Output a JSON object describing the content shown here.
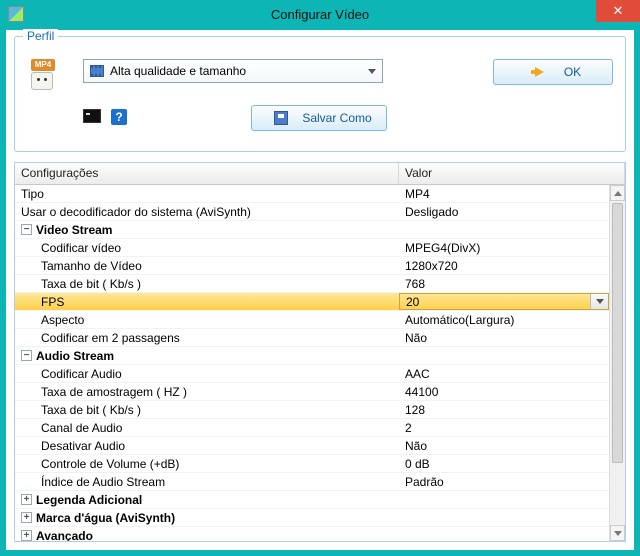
{
  "window": {
    "title": "Configurar Vídeo"
  },
  "fieldset": {
    "legend": "Perfil",
    "format_badge": "MP4",
    "profile_selected": "Alta qualidade e tamanho",
    "ok_label": "OK",
    "help_glyph": "?",
    "save_as_label": "Salvar Como"
  },
  "grid": {
    "header_settings": "Configurações",
    "header_value": "Valor",
    "rows": [
      {
        "kind": "leaf",
        "label": "Tipo",
        "value": "MP4"
      },
      {
        "kind": "leaf",
        "label": "Usar o decodificador do sistema (AviSynth)",
        "value": "Desligado"
      },
      {
        "kind": "group",
        "state": "minus",
        "label": "Video Stream"
      },
      {
        "kind": "child",
        "label": "Codificar vídeo",
        "value": "MPEG4(DivX)"
      },
      {
        "kind": "child",
        "label": "Tamanho de Vídeo",
        "value": "1280x720"
      },
      {
        "kind": "child",
        "label": "Taxa de bit ( Kb/s )",
        "value": "768"
      },
      {
        "kind": "child",
        "label": "FPS",
        "value": "20",
        "selected": true
      },
      {
        "kind": "child",
        "label": "Aspecto",
        "value": "Automático(Largura)"
      },
      {
        "kind": "child",
        "label": "Codificar em 2 passagens",
        "value": "Não"
      },
      {
        "kind": "group",
        "state": "minus",
        "label": "Audio Stream"
      },
      {
        "kind": "child",
        "label": "Codificar Audio",
        "value": "AAC"
      },
      {
        "kind": "child",
        "label": "Taxa de amostragem ( HZ )",
        "value": "44100"
      },
      {
        "kind": "child",
        "label": "Taxa de bit ( Kb/s )",
        "value": "128"
      },
      {
        "kind": "child",
        "label": "Canal de Audio",
        "value": "2"
      },
      {
        "kind": "child",
        "label": "Desativar Audio",
        "value": "Não"
      },
      {
        "kind": "child",
        "label": "Controle de Volume (+dB)",
        "value": "0 dB"
      },
      {
        "kind": "child",
        "label": "Índice de Audio Stream",
        "value": "Padrão"
      },
      {
        "kind": "group",
        "state": "plus",
        "label": "Legenda Adicional"
      },
      {
        "kind": "group",
        "state": "plus",
        "label": "Marca d'água (AviSynth)"
      },
      {
        "kind": "group",
        "state": "plus",
        "label": "Avançado"
      }
    ]
  }
}
